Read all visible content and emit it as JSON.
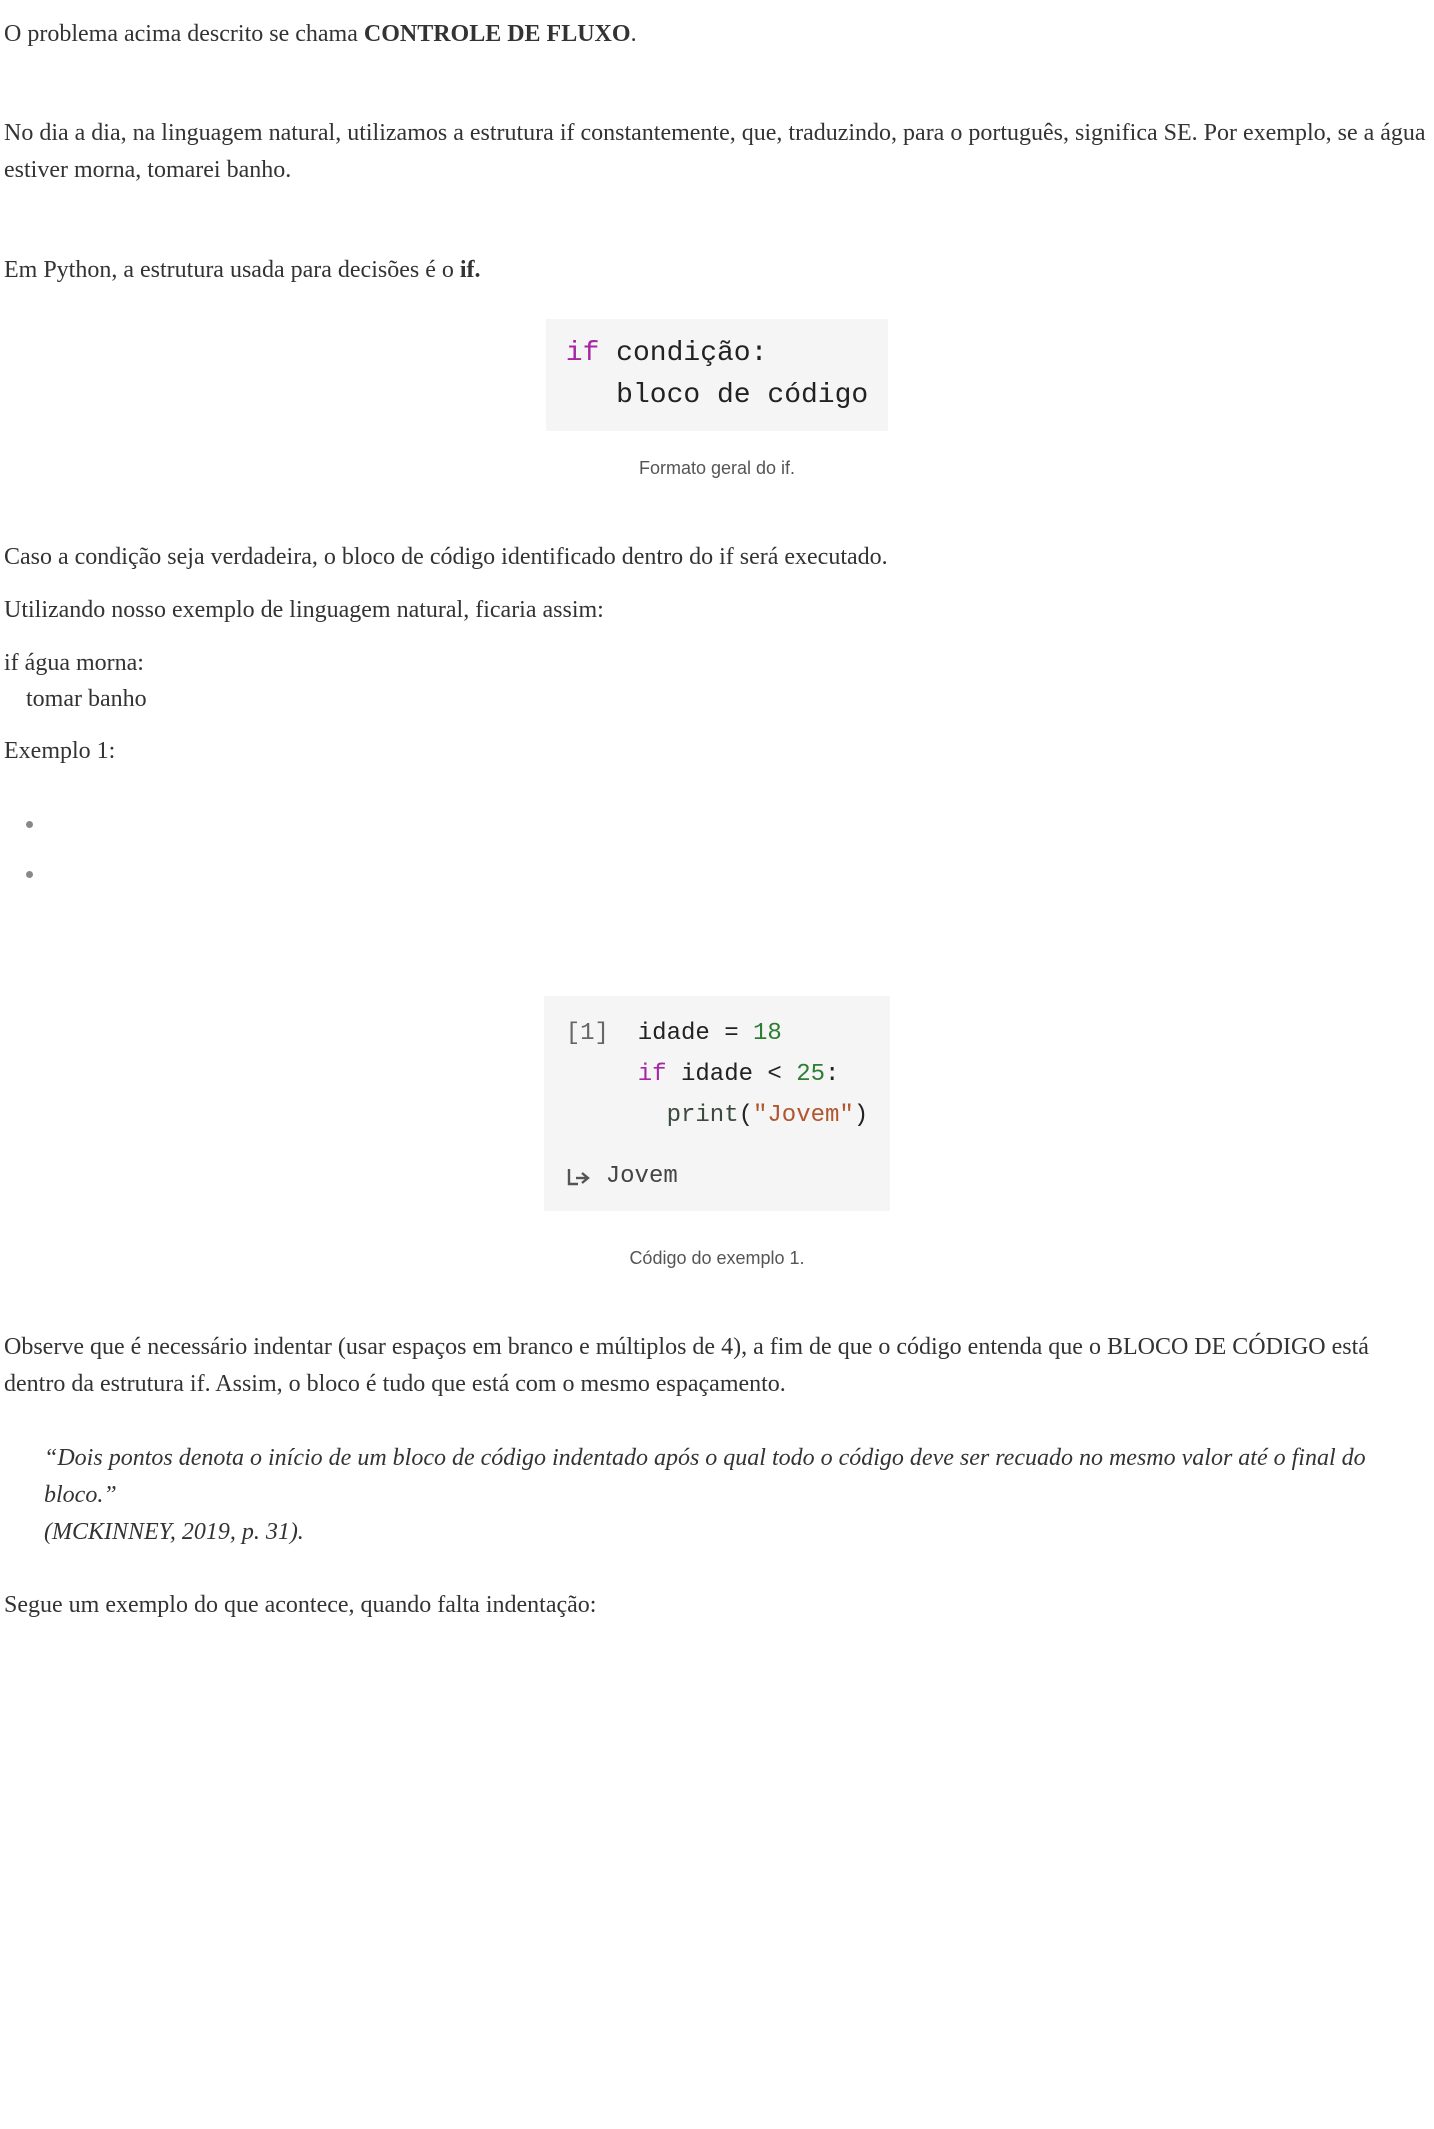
{
  "p1_a": "O problema acima descrito se chama ",
  "p1_b": "CONTROLE DE FLUXO",
  "p1_c": ".",
  "p2": "No dia a dia, na linguagem natural, utilizamos a estrutura if constantemente, que, traduzindo, para o português, significa SE. Por exemplo, se a água estiver morna, tomarei banho.",
  "p3_a": "Em Python, a estrutura usada para decisões é o ",
  "p3_b": "if.",
  "code1": {
    "kw": "if",
    "after_kw": " condição:",
    "line2": "   bloco de código"
  },
  "caption1": "Formato geral do if.",
  "p4": "Caso a condição seja verdadeira, o bloco de código identificado dentro do if será executado.",
  "p5": "Utilizando nosso exemplo de linguagem natural, ficaria assim:",
  "pseudo": {
    "line1": "if água morna:",
    "line2": "tomar banho"
  },
  "p6": "Exemplo 1:",
  "code2": {
    "cell": "[1]",
    "l1_a": "idade = ",
    "l1_num": "18",
    "l2_kw": "if",
    "l2_mid": " idade < ",
    "l2_num": "25",
    "l2_end": ":",
    "l3_fn": "print",
    "l3_paren_open": "(",
    "l3_str": "\"Jovem\"",
    "l3_paren_close": ")",
    "output": "Jovem"
  },
  "caption2": "Código do exemplo 1.",
  "p7": "Observe que é necessário indentar (usar espaços em branco e múltiplos de 4), a fim de que o código entenda que o BLOCO DE CÓDIGO está dentro da estrutura if. Assim, o bloco é tudo que está com o mesmo espaçamento.",
  "quote_l1": "“Dois pontos denota o início de um bloco de código indentado após o qual todo o código deve ser recuado no mesmo valor até o final do bloco.”",
  "quote_l2": "(MCKINNEY, 2019, p. 31).",
  "p8": "Segue um exemplo do que acontece, quando falta indentação:"
}
